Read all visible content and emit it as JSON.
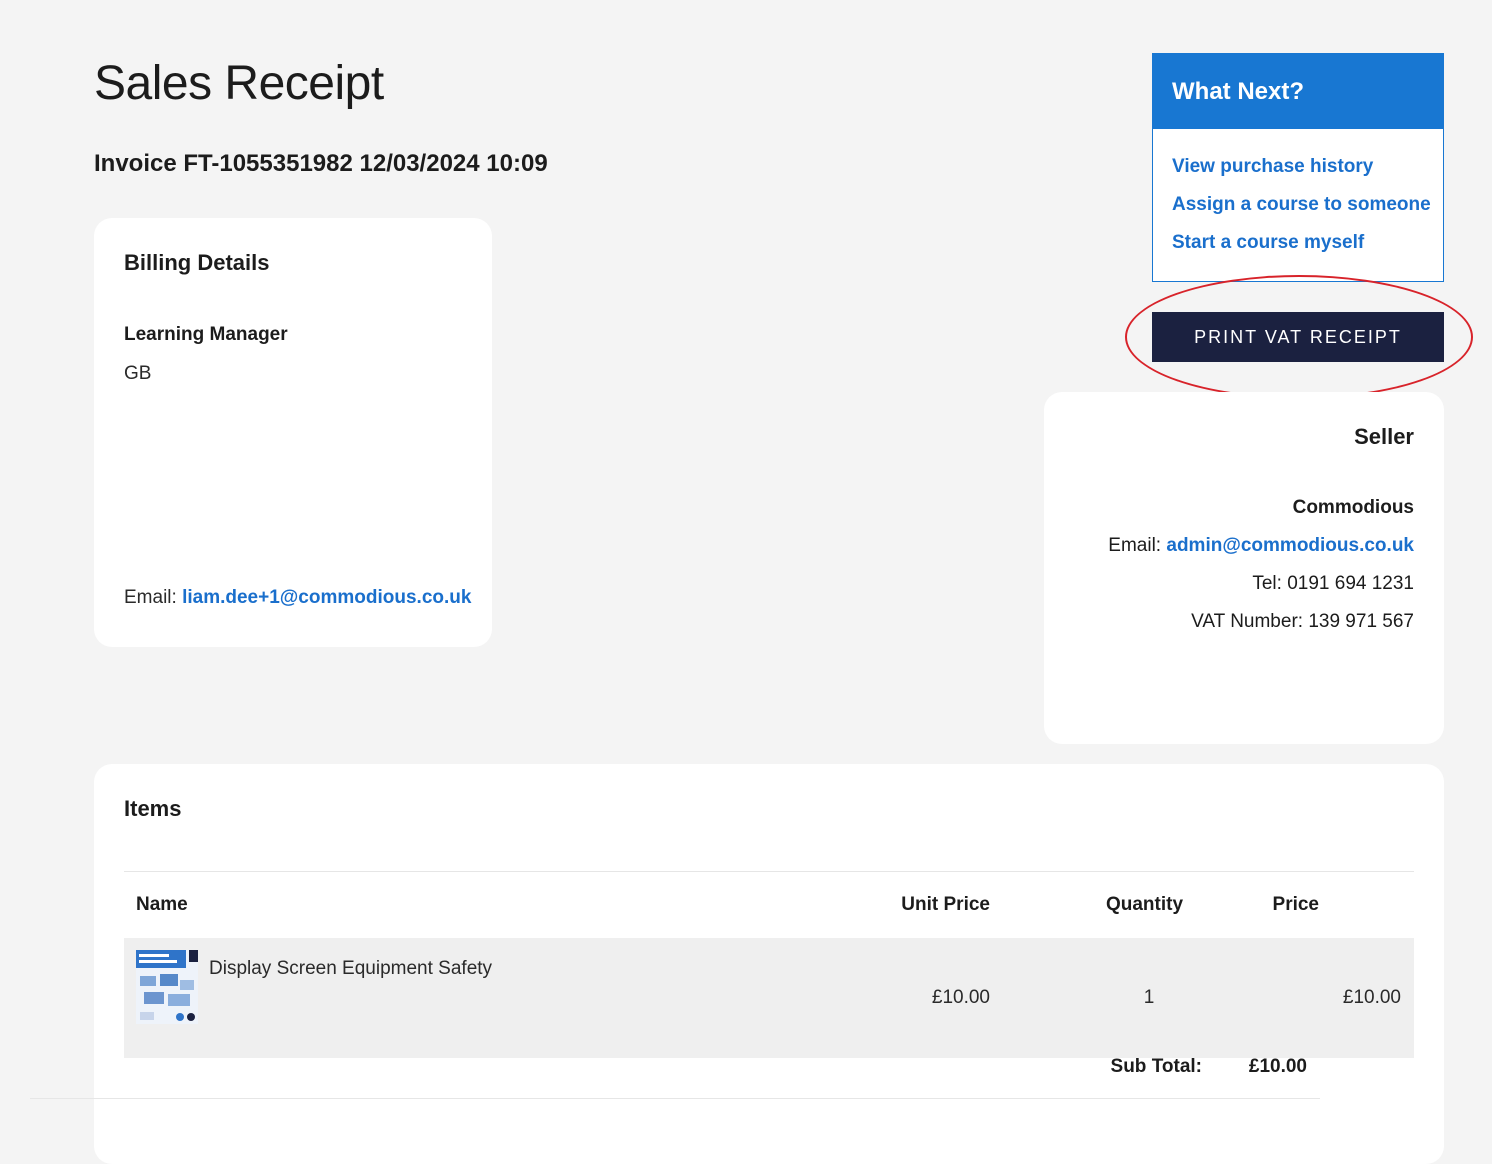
{
  "page": {
    "title": "Sales Receipt",
    "invoice_line": "Invoice FT-1055351982 12/03/2024 10:09"
  },
  "billing": {
    "title": "Billing Details",
    "name": "Learning Manager",
    "country": "GB",
    "email_label": "Email:",
    "email": "liam.dee+1@commodious.co.uk"
  },
  "what_next": {
    "title": "What Next?",
    "links": [
      "View purchase history",
      "Assign a course to someone",
      "Start a course myself"
    ]
  },
  "print_button": "PRINT VAT RECEIPT",
  "seller": {
    "title": "Seller",
    "company": "Commodious",
    "email_label": "Email:",
    "email": "admin@commodious.co.uk",
    "tel": "Tel: 0191 694 1231",
    "vat": "VAT Number: 139 971 567"
  },
  "items": {
    "title": "Items",
    "headers": [
      "Name",
      "Unit Price",
      "Quantity",
      "Price"
    ],
    "rows": [
      {
        "name": "Display Screen Equipment Safety",
        "unit_price": "£10.00",
        "quantity": "1",
        "price": "£10.00"
      }
    ],
    "subtotal_label": "Sub Total:",
    "subtotal_value": "£10.00"
  },
  "colors": {
    "accent": "#1877d2",
    "link": "#1a6fcc",
    "button": "#1b2140",
    "highlight_ring": "#d8232a"
  }
}
